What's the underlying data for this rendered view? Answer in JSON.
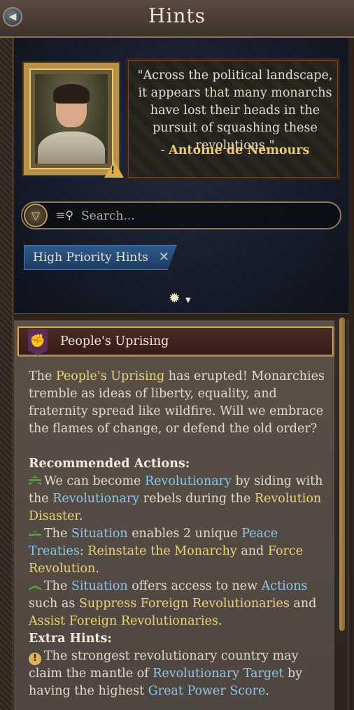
{
  "header": {
    "title": "Hints"
  },
  "quote": {
    "text": "\"Across the political landscape, it appears that many monarchs have lost their heads in the pursuit of squashing these revolutions.\"",
    "prefix": "- ",
    "author": "Antoine de Nemours"
  },
  "search": {
    "placeholder": "Search..."
  },
  "filter_tag": {
    "label": "High Priority Hints"
  },
  "hint": {
    "title": "People's Uprising",
    "intro": {
      "before": "The ",
      "term": "People's Uprising",
      "after": " has erupted! Monarchies tremble as ideas of liberty, equality, and fraternity spread like wildfire. Will we embrace the flames of change, or defend the old order?"
    },
    "recommended_heading": "Recommended Actions:",
    "action1": {
      "a": "We can become ",
      "b": "Revolutionary",
      "c": " by siding with the ",
      "d": "Revolutionary",
      "e": " rebels during the ",
      "f": "Revolution Disaster",
      "g": "."
    },
    "action2": {
      "a": "The ",
      "b": "Situation",
      "c": " enables ",
      "d": "2",
      "e": " unique ",
      "f": "Peace Treaties",
      "g": ": ",
      "h": "Reinstate the Monarchy",
      "i": " and ",
      "j": "Force Revolution",
      "k": "."
    },
    "action3": {
      "a": "The ",
      "b": "Situation",
      "c": " offers access to new ",
      "d": "Actions",
      "e": " such as ",
      "f": "Suppress Foreign Revolutionaries",
      "g": " and ",
      "h": "Assist Foreign Revolutionaries",
      "i": "."
    },
    "extra_heading": "Extra Hints:",
    "extra1": {
      "a": "The strongest revolutionary country may claim the mantle of ",
      "b": "Revolutionary Target",
      "c": " by having the highest ",
      "d": "Great Power Score",
      "e": "."
    }
  },
  "colors": {
    "gold_text": "#ecd37a",
    "blue_text": "#8ec6e8",
    "header_bg": "#4a3d34",
    "tag_bg": "#2e5a8a"
  },
  "icons": {
    "back": "back-arrow-icon",
    "filter": "funnel-icon",
    "search": "search-list-icon",
    "close": "close-x-icon",
    "expand": "sparkle-expand-icon",
    "hint_badge": "red-fist-banner-icon",
    "warning": "warning-triangle-icon",
    "info": "info-exclamation-icon"
  }
}
